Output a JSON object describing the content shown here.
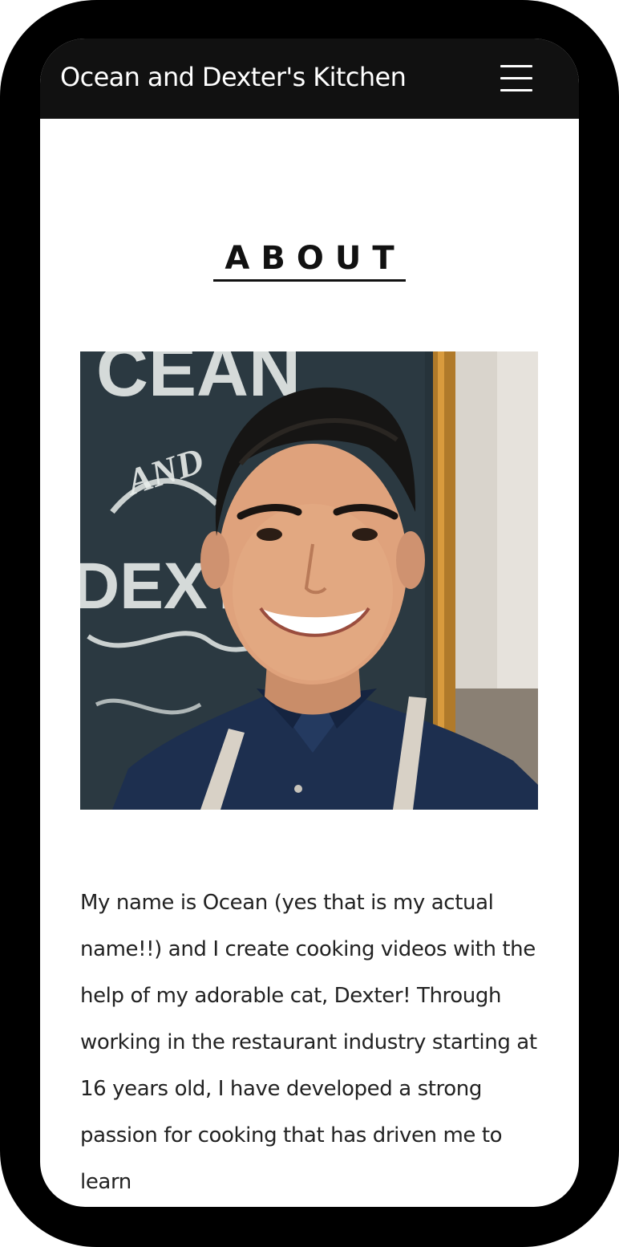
{
  "header": {
    "site_title": "Ocean and Dexter's Kitchen",
    "menu_icon": "hamburger-menu-icon"
  },
  "about": {
    "heading": "ABOUT",
    "image_alt": "Portrait of Ocean smiling in front of a chalkboard sign",
    "chalkboard_text": [
      "CEAN",
      "AND",
      "DEXT"
    ],
    "bio": "My name is Ocean (yes that is my actual name!!) and I create cooking videos with the help of my adorable cat, Dexter! Through working in the restaurant industry starting at 16 years old, I have developed a strong passion for cooking that has driven me to learn"
  },
  "colors": {
    "header_bg": "#111111",
    "frame": "#000000",
    "text": "#222222",
    "shirt": "#1d2f4f",
    "chalkboard": "#26333a"
  }
}
